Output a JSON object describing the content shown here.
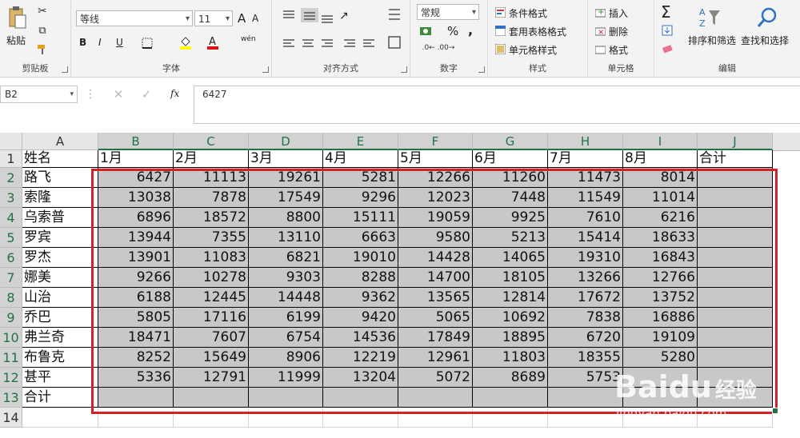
{
  "ribbon": {
    "clipboard": {
      "paste": "粘贴",
      "label": "剪贴板"
    },
    "font": {
      "name": "等线",
      "size": "11",
      "label": "字体",
      "bold": "B",
      "italic": "I",
      "underline": "U",
      "grow": "A",
      "shrink": "A",
      "phonetic": "wén"
    },
    "alignment": {
      "label": "对齐方式"
    },
    "number": {
      "format": "常规",
      "label": "数字",
      "percent": "%",
      "comma": ","
    },
    "styles": {
      "conditional": "条件格式",
      "table": "套用表格格式",
      "cell": "单元格样式",
      "label": "样式"
    },
    "cells": {
      "insert": "插入",
      "delete": "删除",
      "format": "格式",
      "label": "单元格"
    },
    "editing": {
      "sum": "Σ",
      "sort": "排序和筛选",
      "find": "查找和选择",
      "label": "编辑"
    }
  },
  "formula_bar": {
    "name_box": "B2",
    "fx": "fx",
    "content": "6427"
  },
  "columns": [
    "A",
    "B",
    "C",
    "D",
    "E",
    "F",
    "G",
    "H",
    "I",
    "J"
  ],
  "rows": [
    "1",
    "2",
    "3",
    "4",
    "5",
    "6",
    "7",
    "8",
    "9",
    "10",
    "11",
    "12",
    "13",
    "14"
  ],
  "header_row": [
    "姓名",
    "1月",
    "2月",
    "3月",
    "4月",
    "5月",
    "6月",
    "7月",
    "8月",
    "合计"
  ],
  "data_rows": [
    {
      "name": "路飞",
      "values": [
        "6427",
        "11113",
        "19261",
        "5281",
        "12266",
        "11260",
        "11473",
        "8014",
        ""
      ]
    },
    {
      "name": "索隆",
      "values": [
        "13038",
        "7878",
        "17549",
        "9296",
        "12023",
        "7448",
        "11549",
        "11014",
        ""
      ]
    },
    {
      "name": "乌索普",
      "values": [
        "6896",
        "18572",
        "8800",
        "15111",
        "19059",
        "9925",
        "7610",
        "6216",
        ""
      ]
    },
    {
      "name": "罗宾",
      "values": [
        "13944",
        "7355",
        "13110",
        "6663",
        "9580",
        "5213",
        "15414",
        "18633",
        ""
      ]
    },
    {
      "name": "罗杰",
      "values": [
        "13901",
        "11083",
        "6821",
        "19010",
        "14428",
        "14065",
        "19310",
        "16843",
        ""
      ]
    },
    {
      "name": "娜美",
      "values": [
        "9266",
        "10278",
        "9303",
        "8288",
        "14700",
        "18105",
        "13266",
        "12766",
        ""
      ]
    },
    {
      "name": "山治",
      "values": [
        "6188",
        "12445",
        "14448",
        "9362",
        "13565",
        "12814",
        "17672",
        "13752",
        ""
      ]
    },
    {
      "name": "乔巴",
      "values": [
        "5805",
        "17116",
        "6199",
        "9420",
        "5065",
        "10692",
        "7838",
        "16886",
        ""
      ]
    },
    {
      "name": "弗兰奇",
      "values": [
        "18471",
        "7607",
        "6754",
        "14536",
        "17849",
        "18895",
        "6720",
        "19109",
        ""
      ]
    },
    {
      "name": "布鲁克",
      "values": [
        "8252",
        "15649",
        "8906",
        "12219",
        "12961",
        "11803",
        "18355",
        "5280",
        ""
      ]
    },
    {
      "name": "甚平",
      "values": [
        "5336",
        "12791",
        "11999",
        "13204",
        "5072",
        "8689",
        "5753",
        "",
        ""
      ]
    }
  ],
  "total_row_label": "合计",
  "watermark": {
    "brand": "Baidu",
    "cn": "经验",
    "url": "jingyan.baidu.com"
  },
  "colors": {
    "accent": "#217346",
    "highlight": "#d52028",
    "selection": "#c8c8c8"
  }
}
